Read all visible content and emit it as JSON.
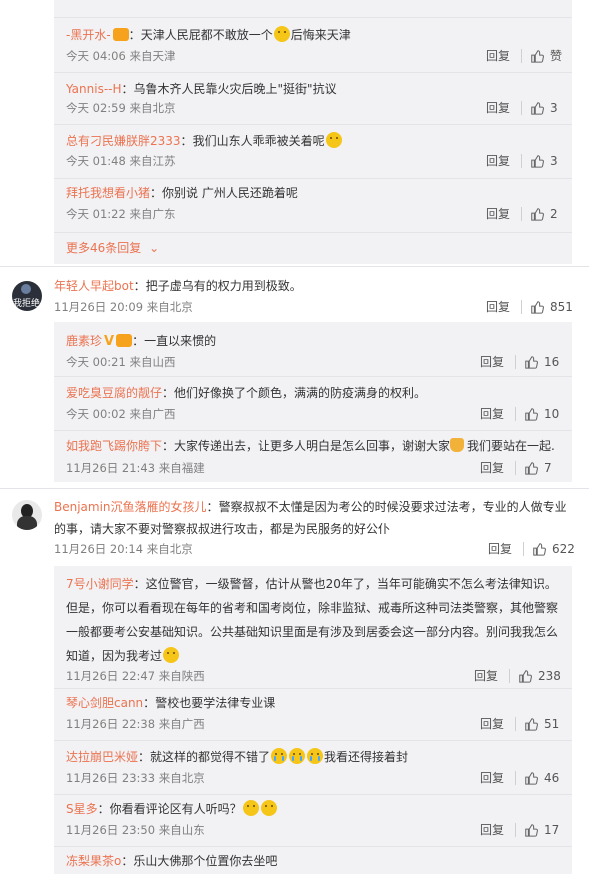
{
  "thread1": {
    "replies": [
      {
        "name": "-黑开水-",
        "text_a": "天津人民屁都不敢放一个",
        "text_b": "后悔来天津",
        "time": "今天 04:06 来自天津",
        "likes": "赞"
      },
      {
        "name": "Yannis--H",
        "text_a": "乌鲁木齐人民靠火灾后晚上\"挺街\"抗议",
        "time": "今天 02:59 来自北京",
        "likes": "3"
      },
      {
        "name": "总有刁民嫌朕胖2333",
        "text_a": "我们山东人乖乖被关着呢",
        "time": "今天 01:48 来自江苏",
        "likes": "3"
      },
      {
        "name": "拜托我想看小猪",
        "text_a": "你别说 广州人民还跪着呢",
        "time": "今天 01:22 来自广东",
        "likes": "2"
      }
    ],
    "more_label": "更多46条回复"
  },
  "comment2": {
    "avatar_text": "我拒绝",
    "name": "年轻人早起bot",
    "text": "把子虚乌有的权力用到极致。",
    "time": "11月26日 20:09 来自北京",
    "likes": "851",
    "replies": [
      {
        "name": "鹿素珍",
        "text_a": "一直以来惯的",
        "time": "今天 00:21 来自山西",
        "likes": "16"
      },
      {
        "name": "爱吃臭豆腐的靓仔",
        "text_a": "他们好像换了个颜色，满满的防疫满身的权利。",
        "time": "今天 00:02 来自广西",
        "likes": "10"
      },
      {
        "name": "如我跑飞踢你胯下",
        "text_a": "大家传递出去，让更多人明白是怎么回事，谢谢大家",
        "text_b": "我们要站在一起.",
        "time": "11月26日 21:43 来自福建",
        "likes": "7"
      }
    ]
  },
  "comment3": {
    "name": "Benjamin沉鱼落雁的女孩儿",
    "text_line1": "警察叔叔不太懂是因为考公的时候没要求过法考，专业的人做专业",
    "text_line2": "的事，请大家不要对警察叔叔进行攻击，都是为民服务的好公仆",
    "time": "11月26日 20:14 来自北京",
    "likes": "622",
    "replies": [
      {
        "name": "7号小谢同学",
        "lines": [
          "这位警官，一级警督，估计从警也20年了，当年可能确实不怎么考法律知识。",
          "但是，你可以看看现在每年的省考和国考岗位，除非监狱、戒毒所这种司法类警察，其他警察",
          "一般都要考公安基础知识。公共基础知识里面是有涉及到居委会这一部分内容。别问我我怎么",
          "知道，因为我考过"
        ],
        "time": "11月26日 22:47 来自陕西",
        "likes": "238"
      },
      {
        "name": "琴心剑胆cann",
        "text_a": "警校也要学法律专业课",
        "time": "11月26日 22:38 来自广西",
        "likes": "51"
      },
      {
        "name": "达拉崩巴米娅",
        "text_a": "就这样的都觉得不错了",
        "text_b": "我看还得接着封",
        "time": "11月26日 23:33 来自北京",
        "likes": "46"
      },
      {
        "name": "S星多",
        "text_a": "你看看评论区有人听吗？",
        "time": "11月26日 23:50 来自山东",
        "likes": "17"
      },
      {
        "name": "冻梨果茶o",
        "text_a": "乐山大佛那个位置你去坐吧"
      }
    ]
  },
  "labels": {
    "reply": "回复",
    "colon": "："
  },
  "colors": {
    "accent": "#eb7350",
    "subbg": "#f2f2f5",
    "meta": "#808080"
  }
}
